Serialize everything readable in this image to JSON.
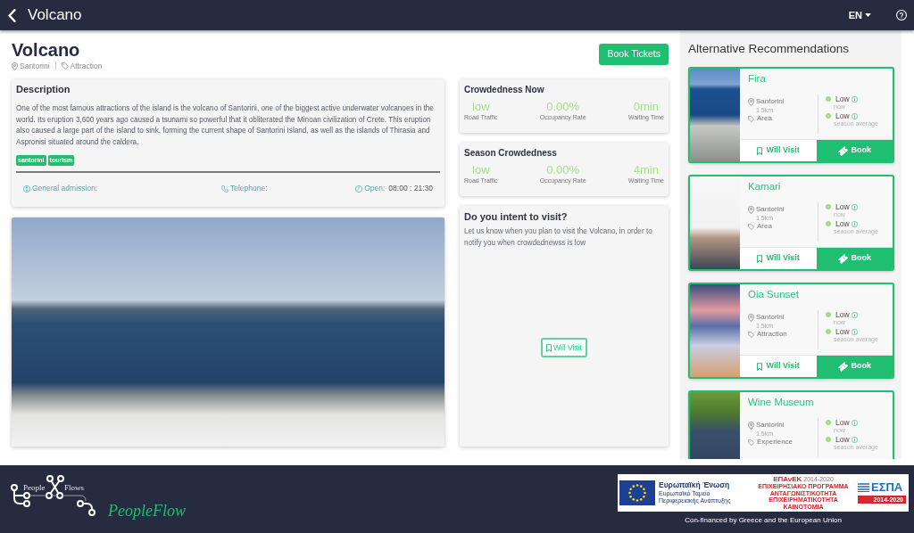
{
  "header": {
    "title": "Volcano",
    "language": "EN"
  },
  "place": {
    "title": "Volcano",
    "location": "Santorini",
    "category": "Attraction",
    "book_button": "Book Tickets"
  },
  "description": {
    "heading": "Description",
    "text": "One of the most famous attractions of the island is the volcano of Santorini, one of the biggest active underwater volcanoes in the world. Its eruption 3,600 years ago caused a tsunami so powerful that it obliterated the Minoan civilization of Crete. This eruption also caused a large part of the island to sink, forming the current shape of Santorini Island, as well as the islands of Thirasia and Aspronisi situated around the caldera.",
    "tags": [
      "santorini",
      "tourism"
    ],
    "admission_label": "General admission:",
    "telephone_label": "Telephone:",
    "hours_label": "Open:",
    "hours": "08:00 : 21:30"
  },
  "crowdedness": [
    {
      "title": "Crowdedness Now",
      "metrics": [
        {
          "value": "low",
          "label": "Road Traffic"
        },
        {
          "value": "0.00%",
          "label": "Occupancy Rate"
        },
        {
          "value": "0min",
          "label": "Waiting Time"
        }
      ]
    },
    {
      "title": "Season Crowdedness",
      "metrics": [
        {
          "value": "low",
          "label": "Road Traffic"
        },
        {
          "value": "0.00%",
          "label": "Occupancy Rate"
        },
        {
          "value": "4min",
          "label": "Waiting Time"
        }
      ]
    }
  ],
  "visit_intent": {
    "title": "Do you intent to visit?",
    "text": "Let us know when you plan to visit the Volcano, in order to notify you when crowdednewss is low",
    "button": "Will Visit"
  },
  "recommendations": {
    "title": "Alternative Recommendations",
    "items": [
      {
        "name": "Fira",
        "location": "Santorini",
        "distance": "1.5km",
        "category": "Area",
        "crowd": [
          {
            "level": "Low",
            "caption": "now",
            "color": "#9fdf85"
          },
          {
            "level": "Low",
            "caption": "season average",
            "color": "#9fdf85"
          }
        ],
        "actions": {
          "will_visit": "Will Visit",
          "book": "Book"
        }
      },
      {
        "name": "Kamari",
        "location": "Santorini",
        "distance": "1.5km",
        "category": "Area",
        "crowd": [
          {
            "level": "Low",
            "caption": "now",
            "color": "#9fdf85"
          },
          {
            "level": "Low",
            "caption": "season average",
            "color": "#9fdf85"
          }
        ],
        "actions": {
          "will_visit": "Will Visit",
          "book": "Book"
        }
      },
      {
        "name": "Oia Sunset",
        "location": "Santorini",
        "distance": "1.5km",
        "category": "Attraction",
        "crowd": [
          {
            "level": "Low",
            "caption": "now",
            "color": "#9fdf85"
          },
          {
            "level": "Low",
            "caption": "season average",
            "color": "#9fdf85"
          }
        ],
        "actions": {
          "will_visit": "Will Visit",
          "book": "Book"
        }
      },
      {
        "name": "Wine Museum",
        "location": "Santorini",
        "distance": "1.5km",
        "category": "Experience",
        "crowd": [
          {
            "level": "Low",
            "caption": "now",
            "color": "#9fdf85"
          },
          {
            "level": "Low",
            "caption": "season average",
            "color": "#9fdf85"
          }
        ]
      }
    ]
  },
  "footer": {
    "logo_words": [
      "People",
      "Flows"
    ],
    "brand": "PeopleFlow",
    "funding_banner": {
      "eu_title": "Ευρωπαϊκή Ένωση",
      "eu_fund": [
        "Ευρωπαϊκό Ταμείο",
        "Περιφερειακής Ανάπτυξης"
      ],
      "programme_name": "ΕΠΑνΕΚ",
      "programme_years": "2014-2020",
      "programme_lines": [
        "ΕΠΙΧΕΙΡΗΣΙΑΚΟ ΠΡΟΓΡΑΜΜΑ",
        "ΑΝΤΑΓΩΝΙΣΤΙΚΟΤΗΤΑ",
        "ΕΠΙΧΕΙΡΗΜΑΤΙΚΟΤΗΤΑ",
        "ΚΑΙΝΟΤΟΜΙΑ"
      ],
      "espa_name": "ΕΣΠΑ",
      "espa_years": "2014-2020"
    },
    "caption": "Con-financed by Greece and the European Union"
  }
}
